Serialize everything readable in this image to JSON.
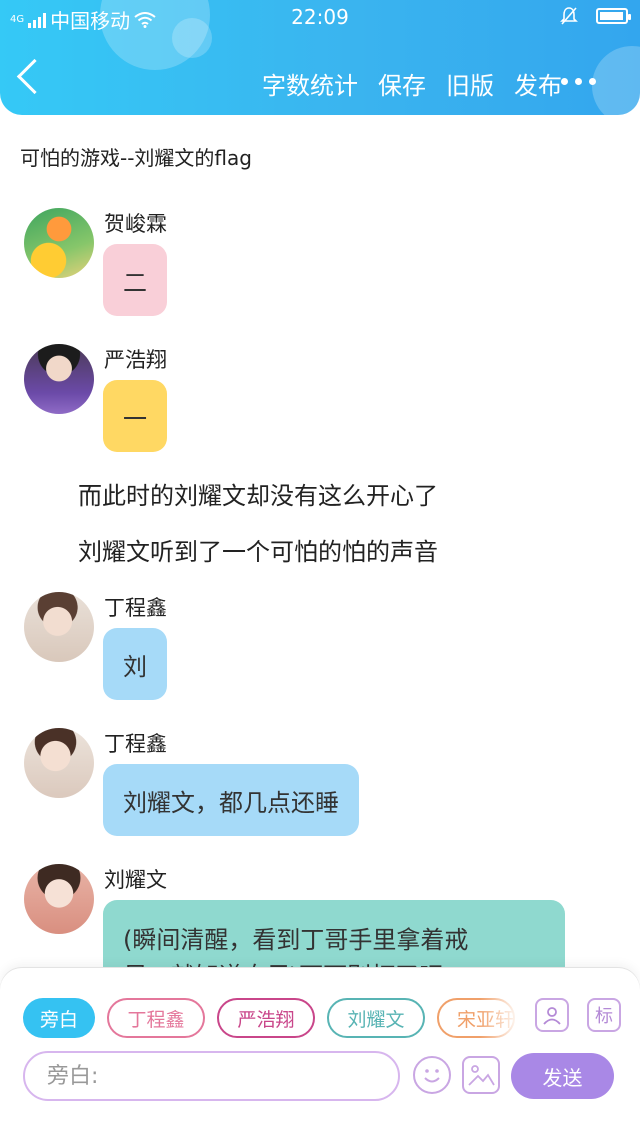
{
  "status_bar": {
    "network": "4G",
    "carrier": "中国移动",
    "time": "22:09",
    "battery_level": 0.95
  },
  "header": {
    "actions": [
      "字数统计",
      "保存",
      "旧版",
      "发布"
    ]
  },
  "doc_title": "可怕的游戏--刘耀文的flag",
  "messages": [
    {
      "speaker": "贺峻霖",
      "text": "二"
    },
    {
      "speaker": "严浩翔",
      "text": "一"
    },
    {
      "narration": "而此时的刘耀文却没有这么开心了"
    },
    {
      "narration": "刘耀文听到了一个可怕的怕的声音"
    },
    {
      "speaker": "丁程鑫",
      "text": "刘"
    },
    {
      "speaker": "丁程鑫",
      "text": "刘耀文，都几点还睡"
    },
    {
      "speaker": "刘耀文",
      "text_line1": "(瞬间清醒，看到丁哥手里拿着戒",
      "text_line2": "尺，就知道自己\\下可别打了吧"
    }
  ],
  "composer": {
    "roles": [
      "旁白",
      "丁程鑫",
      "严浩翔",
      "刘耀文",
      "宋亚轩"
    ],
    "tag_icon_label": "标",
    "input_placeholder": "旁白:",
    "send_label": "发送"
  },
  "colors": {
    "header_gradient": [
      "#35c9f6",
      "#33a6ee"
    ],
    "bubble_pink": "#f9cfd8",
    "bubble_yellow": "#ffd863",
    "bubble_blue": "#a6daf8",
    "bubble_teal": "#8fd9cf",
    "send_button": "#a988e6"
  }
}
